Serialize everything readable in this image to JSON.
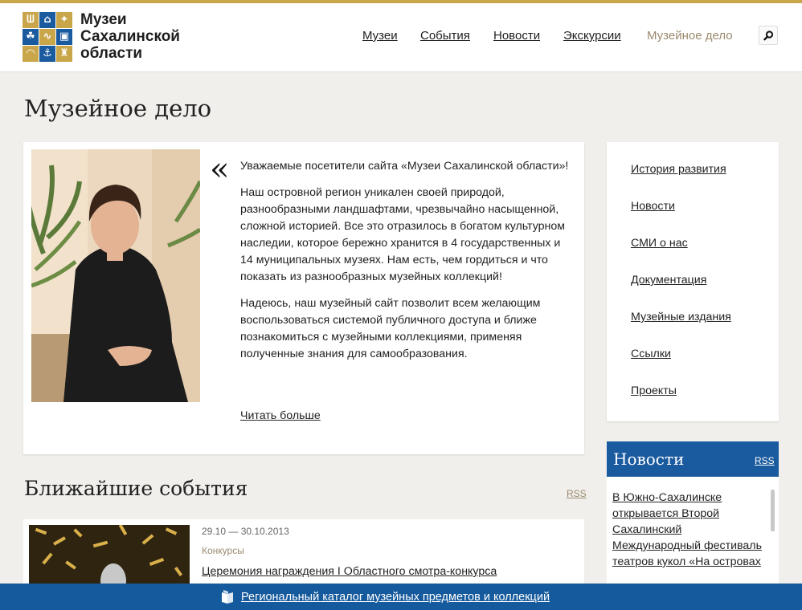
{
  "header": {
    "logo_lines": [
      "Музеи",
      "Сахалинской",
      "области"
    ],
    "nav": [
      {
        "label": "Музеи",
        "active": false
      },
      {
        "label": "События",
        "active": false
      },
      {
        "label": "Новости",
        "active": false
      },
      {
        "label": "Экскурсии",
        "active": false
      },
      {
        "label": "Музейное дело",
        "active": true
      }
    ],
    "search_icon": "search-icon"
  },
  "page_title": "Музейное дело",
  "quote": {
    "mark": "«",
    "paragraphs": [
      "Уважаемые посетители сайта «Музеи Сахалинской области»!",
      "Наш островной регион уникален своей природой, разнообразными ландшафтами, чрезвычайно насыщенной, сложной историей. Все это отразилось в богатом культурном наследии, которое бережно хранится в 4 государственных и 14 муниципальных музеях. Нам есть, чем гордиться и что показать из разнообразных музейных коллекций!",
      "Надеюсь, наш музейный сайт позволит всем желающим воспользоваться системой публичного доступа и ближе познакомиться с музейными коллекциями, применяя полученные знания для самообразования."
    ],
    "read_more": "Читать больше"
  },
  "events": {
    "title": "Ближайшие события",
    "rss": "RSS",
    "items": [
      {
        "date": "29.10 — 30.10.2013",
        "category": "Конкурсы",
        "title": "Церемония награждения I Областного смотра-конкурса"
      }
    ]
  },
  "side_menu": {
    "items": [
      "История развития",
      "Новости",
      "СМИ о нас",
      "Документация",
      "Музейные издания",
      "Ссылки",
      "Проекты"
    ]
  },
  "news": {
    "title": "Новости",
    "rss": "RSS",
    "items": [
      "В Южно-Сахалинске открывается Второй Сахалинский Международный фестиваль театров кукол «На островах"
    ]
  },
  "footer": {
    "catalog_link": "Региональный каталог музейных предметов и коллекций",
    "icon": "book-icon"
  },
  "colors": {
    "accent_gold": "#c9a64a",
    "brand_blue": "#1a5a9e",
    "background": "#f1efec"
  }
}
